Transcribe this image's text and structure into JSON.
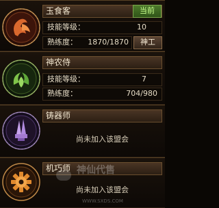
{
  "professions": [
    {
      "name": "玉食客",
      "status": "当前",
      "skill_label": "技能等级：",
      "skill_value": "10",
      "prof_label": "熟练度：",
      "prof_value": "1870/1870",
      "action_label": "神工",
      "icon": "chef-emblem-icon",
      "accent": "#c85a2b"
    },
    {
      "name": "神农侍",
      "skill_label": "技能等级：",
      "skill_value": "7",
      "prof_label": "熟练度：",
      "prof_value": "704/980",
      "icon": "herb-emblem-icon",
      "accent": "#5fa83a"
    },
    {
      "name": "铸器师",
      "not_joined": "尚未加入该盟会",
      "icon": "forge-emblem-icon",
      "accent": "#8a5fb8"
    },
    {
      "name": "机巧师",
      "not_joined": "尚未加入该盟会",
      "icon": "gear-emblem-icon",
      "accent": "#d07a2a"
    }
  ],
  "watermark": {
    "text": "神仙代售",
    "sub": "WWW.SXDS.COM"
  }
}
